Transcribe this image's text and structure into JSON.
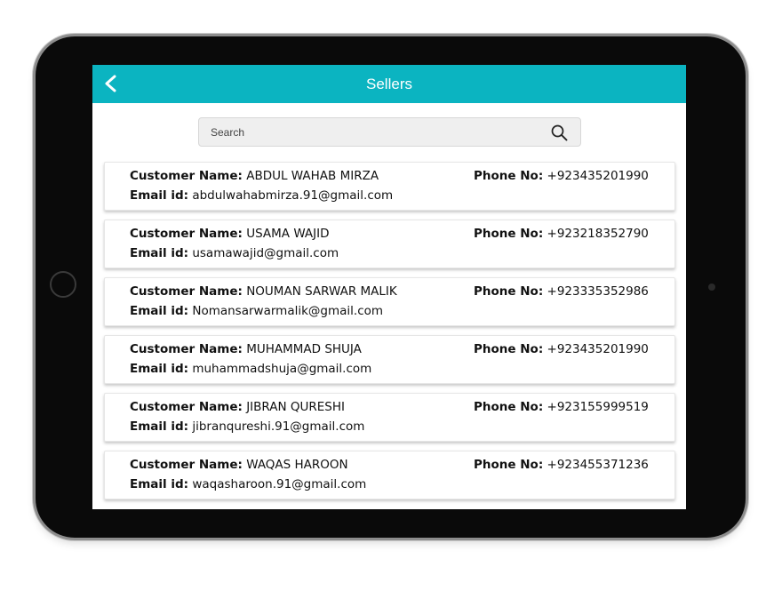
{
  "header": {
    "title": "Sellers"
  },
  "search": {
    "placeholder": "Search",
    "value": ""
  },
  "labels": {
    "customer_name": "Customer Name:",
    "email_id": "Email id:",
    "phone_no": "Phone No:"
  },
  "sellers": [
    {
      "name": "ABDUL WAHAB MIRZA",
      "email": "abdulwahabmirza.91@gmail.com",
      "phone": "+923435201990"
    },
    {
      "name": "USAMA WAJID",
      "email": "usamawajid@gmail.com",
      "phone": "+923218352790"
    },
    {
      "name": "NOUMAN SARWAR MALIK",
      "email": "Nomansarwarmalik@gmail.com",
      "phone": "+923335352986"
    },
    {
      "name": "MUHAMMAD SHUJA",
      "email": "muhammadshuja@gmail.com",
      "phone": "+923435201990"
    },
    {
      "name": "JIBRAN QURESHI",
      "email": "jibranqureshi.91@gmail.com",
      "phone": "+923155999519"
    },
    {
      "name": "WAQAS HAROON",
      "email": "waqasharoon.91@gmail.com",
      "phone": "+923455371236"
    }
  ],
  "colors": {
    "header_bg": "#0bb4c1",
    "header_text": "#ffffff",
    "device_bezel": "#0a0a0a"
  },
  "icons": {
    "back": "chevron-left-icon",
    "search": "search-icon"
  }
}
